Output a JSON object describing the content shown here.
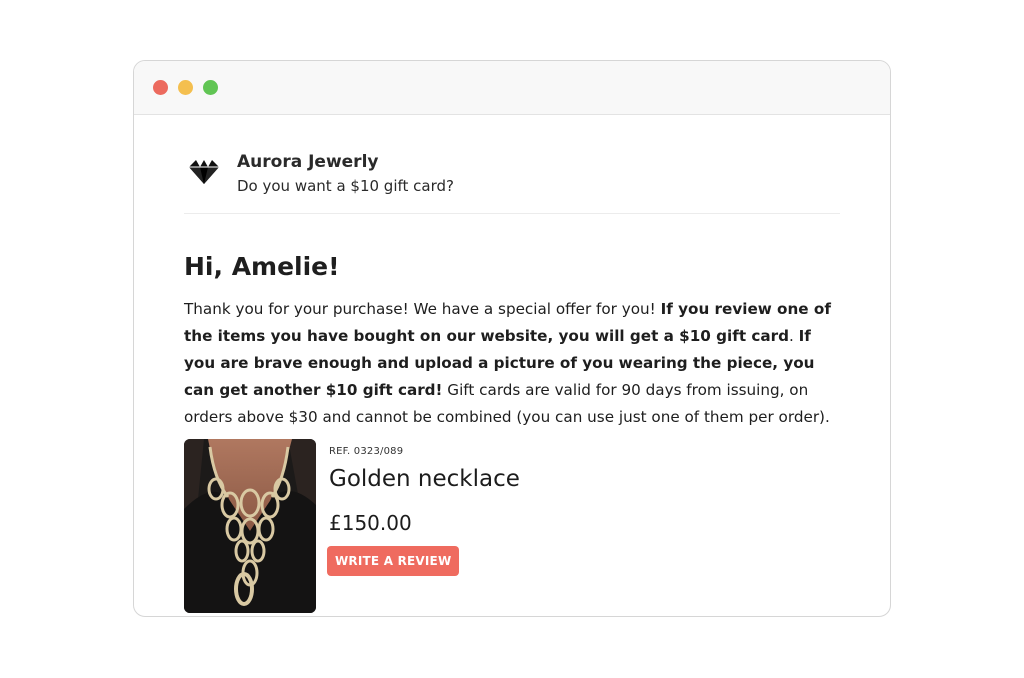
{
  "window": {
    "controls": [
      {
        "name": "close",
        "color": "#ec6a5e"
      },
      {
        "name": "minimize",
        "color": "#f4bf4f"
      },
      {
        "name": "maximize",
        "color": "#61c554"
      }
    ]
  },
  "email": {
    "sender": "Aurora Jewerly",
    "subject": "Do you want a $10 gift card?",
    "logo_icon": "diamond-icon",
    "greeting": "Hi, Amelie!",
    "body": {
      "intro": "Thank you for your purchase! We have a special offer for you! ",
      "bold_review": "If you review one of the items you have bought on our website, you will get a $10 gift card",
      "period": ". ",
      "bold_picture": "If you are brave enough and upload a picture of you wearing the piece, you can get another $10 gift card!",
      "terms": " Gift cards are valid for 90 days from issuing, on orders above $30 and cannot be combined (you can use just one of them per order)."
    }
  },
  "product": {
    "ref": "REF. 0323/089",
    "name": "Golden necklace",
    "price": "£150.00",
    "review_button": "WRITE A REVIEW",
    "accent_color": "#ef6b5f"
  }
}
